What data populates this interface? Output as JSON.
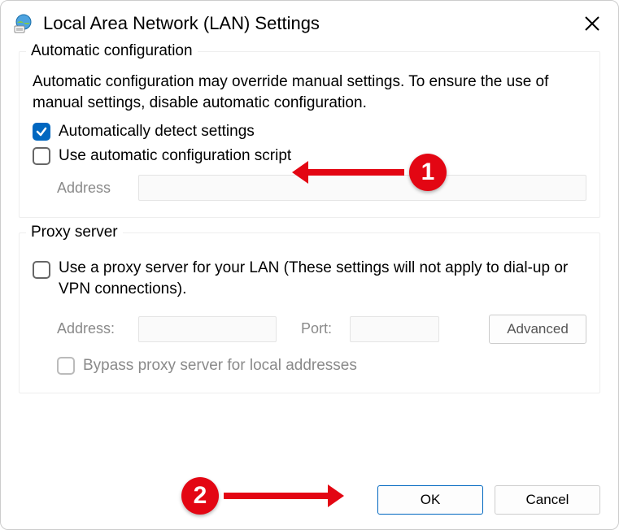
{
  "window": {
    "title": "Local Area Network (LAN) Settings"
  },
  "auto": {
    "group_title": "Automatic configuration",
    "description": "Automatic configuration may override manual settings.  To ensure the use of manual settings, disable automatic configuration.",
    "detect_label": "Automatically detect settings",
    "detect_checked": true,
    "script_label": "Use automatic configuration script",
    "script_checked": false,
    "address_label": "Address"
  },
  "proxy": {
    "group_title": "Proxy server",
    "use_label": "Use a proxy server for your LAN (These settings will not apply to dial-up or VPN connections).",
    "use_checked": false,
    "address_label": "Address:",
    "port_label": "Port:",
    "advanced_label": "Advanced",
    "bypass_label": "Bypass proxy server for local addresses",
    "bypass_checked": false
  },
  "buttons": {
    "ok": "OK",
    "cancel": "Cancel"
  },
  "annotations": {
    "b1": "1",
    "b2": "2"
  }
}
